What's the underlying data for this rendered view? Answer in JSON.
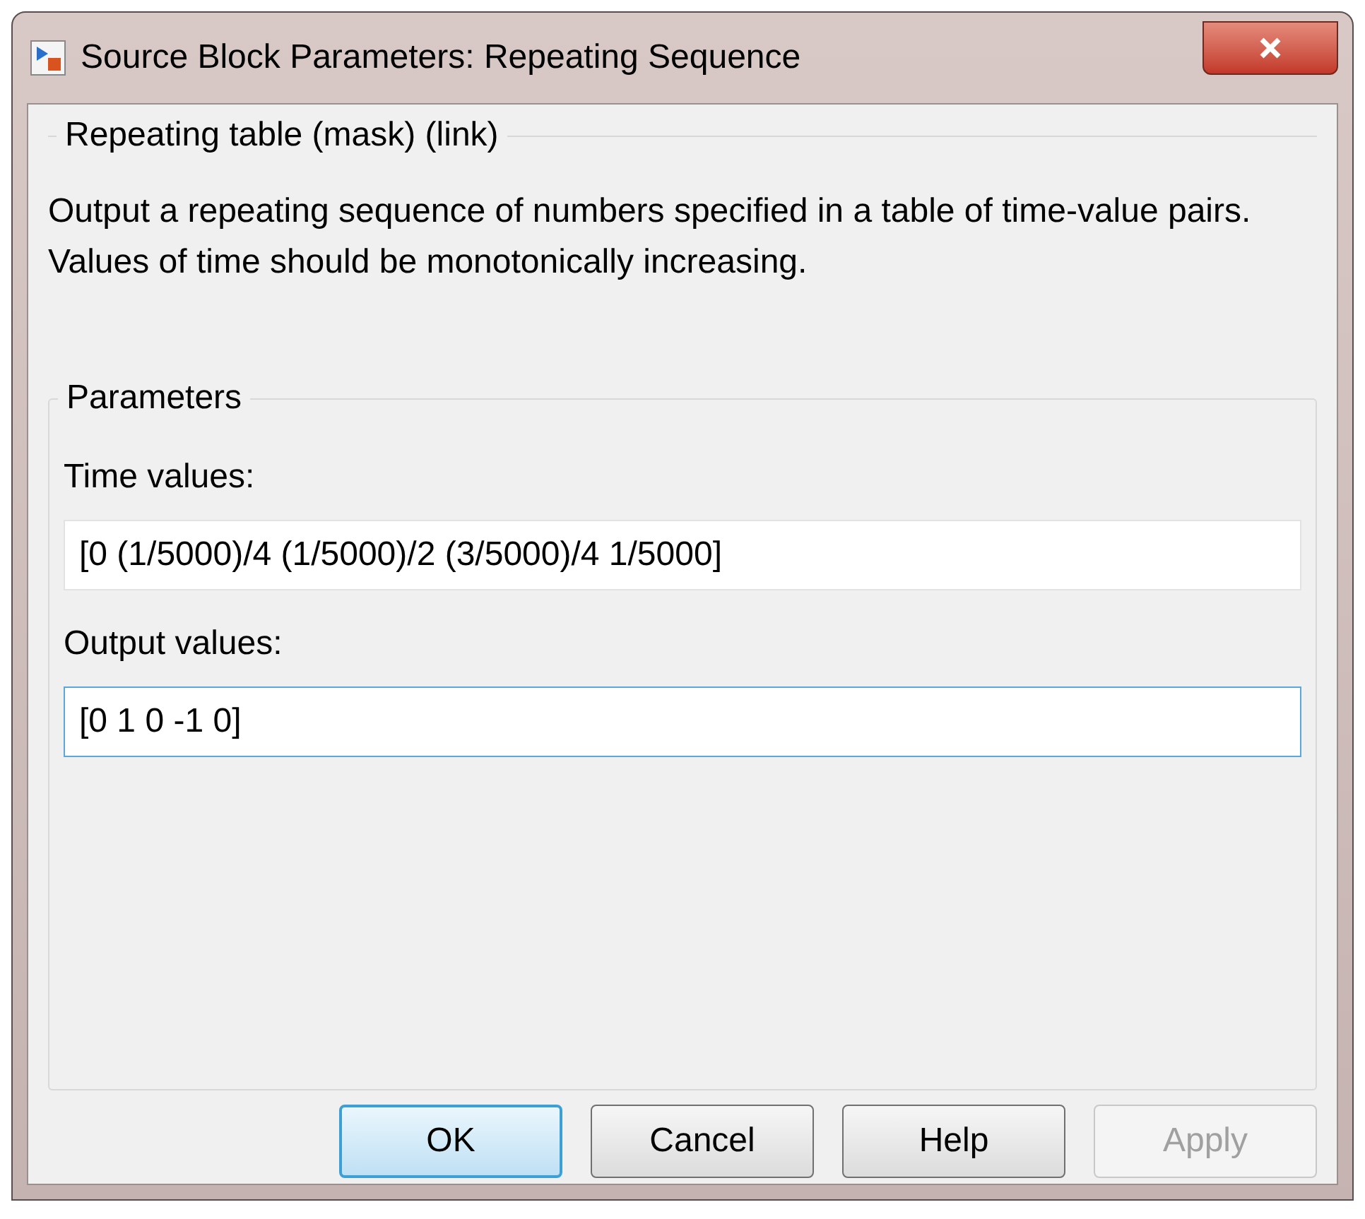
{
  "window": {
    "title": "Source Block Parameters: Repeating Sequence"
  },
  "description_group": {
    "title": "Repeating table (mask) (link)",
    "text": "Output a repeating sequence of numbers specified in a table of time-value pairs. Values of time should be monotonically increasing."
  },
  "parameters_group": {
    "title": "Parameters",
    "fields": [
      {
        "label": "Time values:",
        "value": "[0 (1/5000)/4 (1/5000)/2 (3/5000)/4 1/5000]",
        "focused": false
      },
      {
        "label": "Output values:",
        "value": "[0 1 0 -1 0]",
        "focused": true
      }
    ]
  },
  "buttons": [
    {
      "label": "OK",
      "default": true,
      "disabled": false
    },
    {
      "label": "Cancel",
      "default": false,
      "disabled": false
    },
    {
      "label": "Help",
      "default": false,
      "disabled": false
    },
    {
      "label": "Apply",
      "default": false,
      "disabled": true
    }
  ]
}
